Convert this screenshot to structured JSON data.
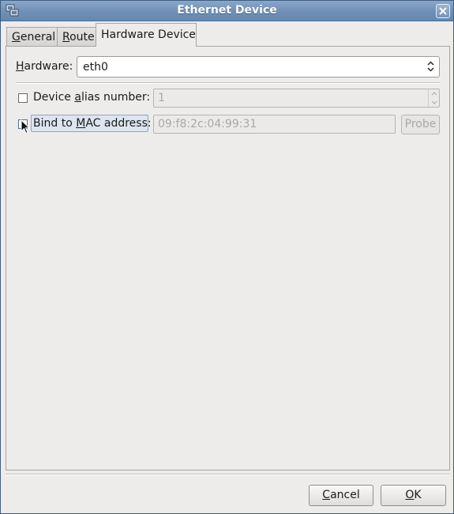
{
  "window": {
    "title": "Ethernet Device",
    "icons": {
      "app": "network-device-icon",
      "close": "close-icon"
    }
  },
  "tabs": [
    {
      "label": "General",
      "mnemonic": "G",
      "rest": "eneral",
      "active": false
    },
    {
      "label": "Route",
      "mnemonic": "R",
      "rest": "oute",
      "active": false
    },
    {
      "label": "Hardware Device",
      "active": true
    }
  ],
  "hardware": {
    "label_pre": "",
    "label_mnemonic": "H",
    "label_rest": "ardware:",
    "value": "eth0"
  },
  "alias": {
    "label_pre": "Device ",
    "label_mnemonic": "a",
    "label_rest": "lias number:",
    "checked": false,
    "value": "1"
  },
  "mac": {
    "label_pre": "Bind to ",
    "label_mnemonic": "M",
    "label_rest": "AC address:",
    "checked": false,
    "value": "09:f8:2c:04:99:31",
    "probe_label": "Probe"
  },
  "buttons": {
    "cancel_mnemonic": "C",
    "cancel_rest": "ancel",
    "ok_mnemonic": "O",
    "ok_rest": "K"
  },
  "colors": {
    "titlebar": "#6f8fb5",
    "focus_highlight": "#dde5ef",
    "disabled_text": "#a9a8a6"
  }
}
